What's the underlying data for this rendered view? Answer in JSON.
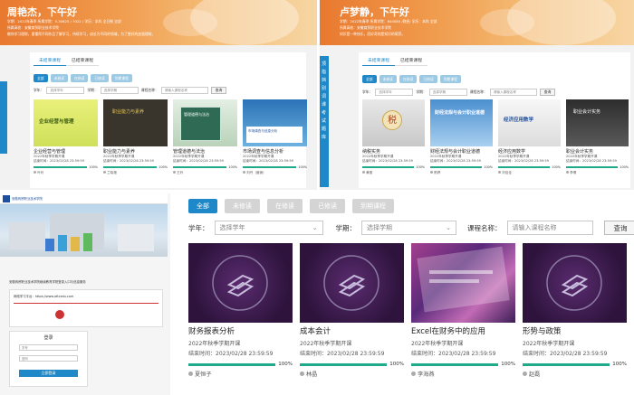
{
  "panel_tl": {
    "greeting": "周艳杰，下午好",
    "info_line1": "学期：2022年春季  所属学院：5.30625 / 7022 /  学历：本科 全日制 全部",
    "info_line2": "所属高校：安徽商贸职业技术学院",
    "info_line3": "教你学习理财，要懂得不同作品了解学习，持续学习，成长为不同的领域，为了更好的加强理财。",
    "tabs": [
      "未结束课程",
      "已结束课程"
    ],
    "pills": [
      "全部",
      "未修读",
      "在修读",
      "已修读",
      "到期课程"
    ],
    "filter_term_label": "学年：",
    "filter_term_value": "选择学年",
    "filter_sem_label": "学期：",
    "filter_sem_value": "选择学期",
    "filter_course_label": "课程名称：",
    "filter_course_value": "请输入课程名称",
    "search_label": "查询",
    "courses": [
      {
        "name": "企业经营与管理",
        "thumb_text": "企业经营与管理",
        "term": "2022年秋季学期开课",
        "end": "结束时间：2023/02/28 23:59:59",
        "progress": 100,
        "pct": "100%",
        "teacher": "叶玲"
      },
      {
        "name": "职业能力与素养",
        "thumb_text": "职业能力与素养",
        "term": "2022年秋季学期开课",
        "end": "结束时间：2023/02/28 23:59:59",
        "progress": 100,
        "pct": "100%",
        "teacher": "兰晓艳"
      },
      {
        "name": "管理道德与法治",
        "thumb_text": "管理道德与法治",
        "term": "2022年秋季学期开课",
        "end": "结束时间：2023/02/28 23:59:59",
        "progress": 100,
        "pct": "100%",
        "teacher": "王玲"
      },
      {
        "name": "市场调查与信息分析",
        "thumb_text": "市场调查与信息分析",
        "term": "2022年秋季学期开课",
        "end": "结束时间：2023/02/28 23:59:59",
        "progress": 100,
        "pct": "100%",
        "teacher": "刘丹（营销）"
      }
    ]
  },
  "panel_tr": {
    "greeting": "卢梦静，下午好",
    "info_line1": "学期：2022年春季  所属学院：840085 /财经/ 学历：本科 全部",
    "info_line2": "所属高校：安徽商贸职业技术学院",
    "info_line3": "知识是一种快乐，而好奇则是知识的萌芽。",
    "tabs": [
      "未结束课程",
      "已结束课程"
    ],
    "pills": [
      "全部",
      "未修读",
      "在修读",
      "已修读",
      "到期课程"
    ],
    "filter_term_label": "学年：",
    "filter_term_value": "选择学年",
    "filter_sem_label": "学期：",
    "filter_sem_value": "选择学期",
    "filter_course_label": "课程名称：",
    "filter_course_value": "请输入课程名称",
    "search_label": "查询",
    "side_items": [
      "顶",
      "指",
      "挡",
      "别",
      "词",
      "课",
      "考",
      "试",
      "题",
      "库"
    ],
    "courses": [
      {
        "name": "纳税实务",
        "thumb_text": "税",
        "term": "2022年秋季学期开课",
        "end": "结束时间：2023/02/28 23:59:59",
        "progress": 100,
        "pct": "100%",
        "teacher": "黄丽"
      },
      {
        "name": "财经法规与会计职业道德",
        "thumb_text": "财经法规与会计职业道德",
        "term": "2022年秋季学期开课",
        "end": "结束时间：2023/02/28 23:59:59",
        "progress": 100,
        "pct": "100%",
        "teacher": "陈婷"
      },
      {
        "name": "经济应用数学",
        "thumb_text": "经济应用数学",
        "term": "2022年秋季学期开课",
        "end": "结束时间：2023/02/28 23:59:59",
        "progress": 100,
        "pct": "100%",
        "teacher": "刘佳佳"
      },
      {
        "name": "职业会计实务",
        "thumb_text": "职业会计实务",
        "term": "2022年秋季学期开课",
        "end": "结束时间：2023/02/28 23:59:59",
        "progress": 100,
        "pct": "100%",
        "teacher": "李倩"
      }
    ]
  },
  "panel_bl": {
    "header_text": "安徽商贸职业技术学院",
    "caption": "安徽商贸职业技术学院继续教育学院登录入口与信息服务",
    "url_text": "网络学习平台：https://www.attcedu.com",
    "login_title": "登录",
    "username_placeholder": "学号",
    "password_placeholder": "密码",
    "login_button": "立即登录"
  },
  "panel_br": {
    "tabs": [
      "全部",
      "未修读",
      "在修读",
      "已修读",
      "到期课程"
    ],
    "filter_term_label": "学年：",
    "filter_term_value": "选择学年",
    "filter_sem_label": "学期：",
    "filter_sem_value": "选择学期",
    "filter_course_label": "课程名称：",
    "filter_course_value": "请输入课程名称",
    "search_label": "查询",
    "courses": [
      {
        "name": "财务报表分析",
        "term": "2022年秋季学期开课",
        "end": "结束时间：2023/02/28 23:59:59",
        "progress": 100,
        "pct": "100%",
        "teacher": "夏恒子"
      },
      {
        "name": "成本会计",
        "term": "2022年秋季学期开课",
        "end": "结束时间：2023/02/28 23:59:59",
        "progress": 100,
        "pct": "100%",
        "teacher": "林晶"
      },
      {
        "name": "Excel在财务中的应用",
        "term": "2022年秋季学期开课",
        "end": "结束时间：2023/02/28 23:59:59",
        "progress": 100,
        "pct": "100%",
        "teacher": "李海燕"
      },
      {
        "name": "形势与政策",
        "term": "2022年秋季学期开课",
        "end": "结束时间：2023/02/28 23:59:59",
        "progress": 100,
        "pct": "100%",
        "teacher": "赵磊"
      }
    ]
  },
  "colors": {
    "accent": "#1e88c8",
    "progress": "#1faa8a",
    "banner": "#e8792f"
  }
}
